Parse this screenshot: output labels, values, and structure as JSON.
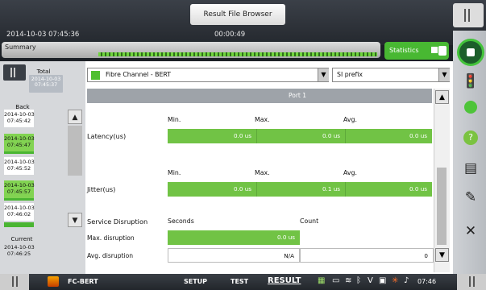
{
  "window": {
    "title": "Result File Browser"
  },
  "status": {
    "timestamp": "2014-10-03 07:45:36",
    "elapsed": "00:00:49"
  },
  "summary": {
    "label": "Summary",
    "progress": 1.0
  },
  "statistics": {
    "label": "Statistics"
  },
  "left_panel": {
    "total_label": "Total",
    "total_btn": "2014-10-03\n07:45:37",
    "back_label": "Back",
    "entries": [
      "2014-10-03\n07:45:42",
      "2014-10-03\n07:45:47",
      "2014-10-03\n07:45:52",
      "2014-10-03\n07:45:57",
      "2014-10-03\n07:46:02"
    ],
    "current_label": "Current",
    "current_time": "2014-10-03\n07:46:25"
  },
  "main": {
    "protocol_select": "Fibre Channel - BERT",
    "prefix_select": "SI prefix",
    "port_label": "Port 1",
    "latency": {
      "label": "Latency(us)",
      "min_hdr": "Min.",
      "max_hdr": "Max.",
      "avg_hdr": "Avg.",
      "min": "0.0 us",
      "max": "0.0 us",
      "avg": "0.0 us"
    },
    "jitter": {
      "label": "Jitter(us)",
      "min_hdr": "Min.",
      "max_hdr": "Max.",
      "avg_hdr": "Avg.",
      "min": "0.0 us",
      "max": "0.1 us",
      "avg": "0.0 us"
    },
    "disruption": {
      "label": "Service Disruption",
      "seconds_hdr": "Seconds",
      "count_hdr": "Count",
      "max_label": "Max. disruption",
      "max_value": "0.0 us",
      "avg_label": "Avg. disruption",
      "avg_value": "N/A",
      "count_value": "0"
    }
  },
  "bottom": {
    "app": "FC-BERT",
    "setup": "SETUP",
    "test": "TEST",
    "result": "RESULT",
    "time": "07:46"
  }
}
